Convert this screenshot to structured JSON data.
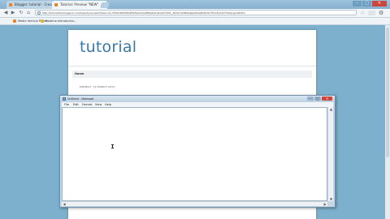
{
  "browser": {
    "tabs": [
      {
        "label": "Blogger: tutorial - Crea",
        "active": false
      },
      {
        "label": "Tutorial: Preview \"NEW\"",
        "active": true
      }
    ],
    "url": "http://tutorialitiv.blogspot.com/b/post-preview?token=1L7VMxDRSDOEeEEk5a0zC2e6E9yRAbxRvkXhTVM__NCSX7ibtIBqeRyleWsleEkEvtk7T53vD1LK7T1dbJngenPOIVC",
    "bookmarks": [
      {
        "label": "Media Vertical Power..."
      },
      {
        "label": "Postime teknoturkiu..."
      }
    ],
    "window_controls": {
      "minimize": "–",
      "maximize": "□",
      "close": "✕"
    },
    "nav": {
      "back": "◀",
      "forward": "▶",
      "reload": "↻",
      "home": "⌂",
      "star": "☆",
      "wrench": "⚙"
    }
  },
  "blog": {
    "title": "tutorial",
    "nav_label": "Home",
    "post_date": "MONDAY, 14 MARCH 2011"
  },
  "notepad": {
    "title": "Untitled - Notepad",
    "menus": [
      "File",
      "Edit",
      "Format",
      "View",
      "Help"
    ],
    "controls": {
      "minimize": "–",
      "maximize": "□",
      "close": "✕"
    },
    "text": ""
  },
  "colors": {
    "desktop_bg": "#7cb0cc",
    "blog_title": "#3a78a8",
    "close_button": "#c9473d"
  }
}
